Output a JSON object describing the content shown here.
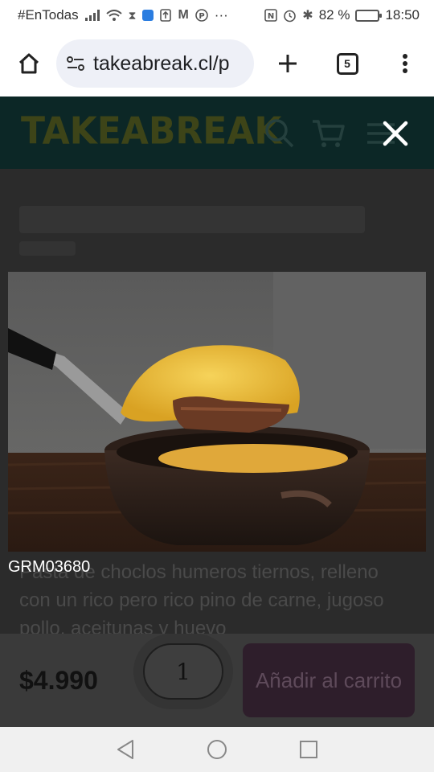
{
  "status_bar": {
    "carrier_text": "#EnTodas",
    "more": "···",
    "battery_text": "82 %",
    "time": "18:50",
    "battery_level": 0.82
  },
  "browser": {
    "url": "takeabreak.cl/p",
    "tab_count": "5"
  },
  "site": {
    "logo": "TAKEABREAK",
    "accent_color": "#3d4418"
  },
  "lightbox": {
    "caption": "GRM03680"
  },
  "product": {
    "description": "Pasta de choclos humeros tiernos, relleno con un rico pero rico pino de carne, jugoso pollo, aceitunas y huevo",
    "price": "$4.990",
    "quantity": "1",
    "add_to_cart": "Añadir al carrito"
  }
}
